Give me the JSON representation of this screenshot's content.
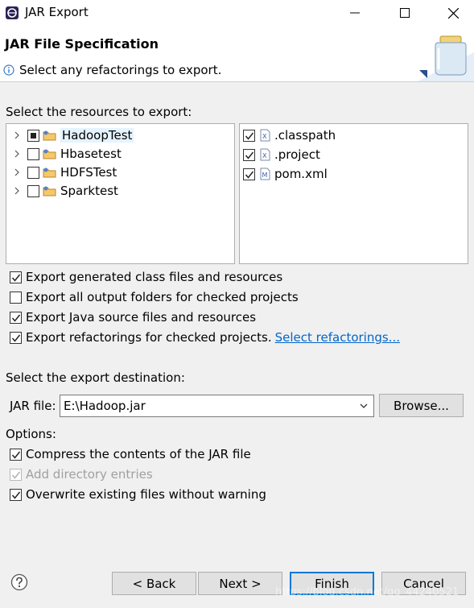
{
  "window": {
    "title": "JAR Export",
    "controls": {
      "minimize": "minimize",
      "maximize": "maximize",
      "close": "close"
    }
  },
  "header": {
    "title": "JAR File Specification",
    "message": "Select any refactorings to export."
  },
  "resources": {
    "label": "Select the resources to export:",
    "projects": [
      {
        "name": "HadoopTest",
        "state": "partial",
        "selected": true
      },
      {
        "name": "Hbasetest",
        "state": "unchecked",
        "selected": false
      },
      {
        "name": "HDFSTest",
        "state": "unchecked",
        "selected": false
      },
      {
        "name": "Sparktest",
        "state": "unchecked",
        "selected": false
      }
    ],
    "files": [
      {
        "name": ".classpath",
        "checked": true,
        "icon": "xml-file-icon"
      },
      {
        "name": ".project",
        "checked": true,
        "icon": "xml-file-icon"
      },
      {
        "name": "pom.xml",
        "checked": true,
        "icon": "maven-file-icon"
      }
    ]
  },
  "export_options": {
    "generated_class": {
      "label": "Export generated class files and resources",
      "checked": true
    },
    "output_folders": {
      "label": "Export all output folders for checked projects",
      "checked": false
    },
    "java_source": {
      "label": "Export Java source files and resources",
      "checked": true
    },
    "refactorings": {
      "label": "Export refactorings for checked projects.",
      "checked": true,
      "link": "Select refactorings..."
    }
  },
  "destination": {
    "label": "Select the export destination:",
    "jar_label": "JAR file:",
    "jar_value": "E:\\Hadoop.jar",
    "browse": "Browse..."
  },
  "options": {
    "label": "Options:",
    "compress": {
      "label": "Compress the contents of the JAR file",
      "checked": true
    },
    "directory": {
      "label": "Add directory entries",
      "checked": true,
      "disabled": true
    },
    "overwrite": {
      "label": "Overwrite existing files without warning",
      "checked": true
    }
  },
  "footer": {
    "back": "< Back",
    "next": "Next >",
    "finish": "Finish",
    "cancel": "Cancel",
    "watermark": "https://blog.csdn.net/qq_44240521"
  }
}
